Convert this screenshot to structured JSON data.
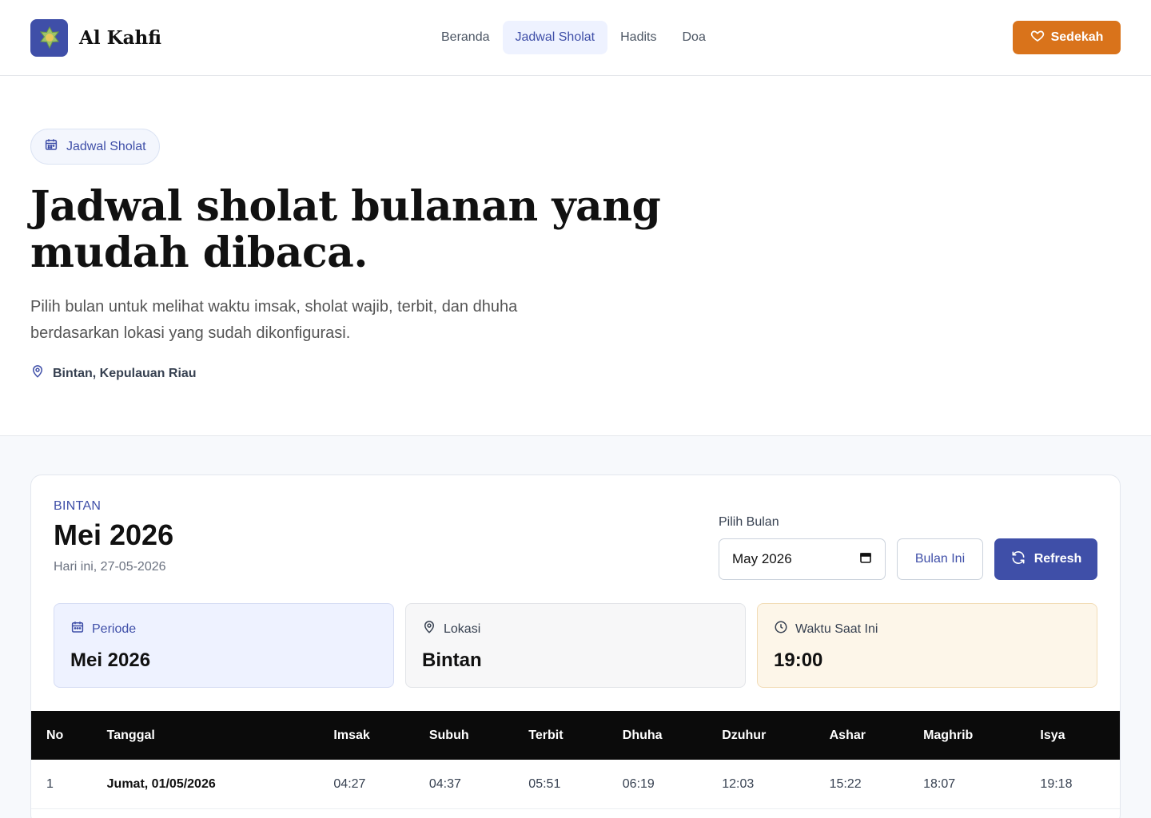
{
  "brand": {
    "name": "Al Kahfi",
    "logo_icon": "mosque-star-icon"
  },
  "nav": {
    "items": [
      {
        "label": "Beranda",
        "active": false
      },
      {
        "label": "Jadwal Sholat",
        "active": true
      },
      {
        "label": "Hadits",
        "active": false
      },
      {
        "label": "Doa",
        "active": false
      }
    ]
  },
  "donate": {
    "label": "Sedekah",
    "icon": "heart-icon"
  },
  "hero": {
    "badge": "Jadwal Sholat",
    "title": "Jadwal sholat bulanan yang mudah dibaca.",
    "description": "Pilih bulan untuk melihat waktu imsak, sholat wajib, terbit, dan dhuha berdasarkan lokasi yang sudah dikonfigurasi.",
    "location": "Bintan, Kepulauan Riau"
  },
  "schedule": {
    "city_kicker": "BINTAN",
    "title": "Mei 2026",
    "today": "Hari ini, 27-05-2026",
    "picker_label": "Pilih Bulan",
    "picker_value": "May 2026",
    "this_month_label": "Bulan Ini",
    "refresh_label": "Refresh"
  },
  "info": {
    "period": {
      "label": "Periode",
      "value": "Mei 2026"
    },
    "location": {
      "label": "Lokasi",
      "value": "Bintan"
    },
    "time": {
      "label": "Waktu Saat Ini",
      "value": "19:00"
    }
  },
  "table": {
    "headers": [
      "No",
      "Tanggal",
      "Imsak",
      "Subuh",
      "Terbit",
      "Dhuha",
      "Dzuhur",
      "Ashar",
      "Maghrib",
      "Isya"
    ],
    "rows": [
      [
        "1",
        "Jumat, 01/05/2026",
        "04:27",
        "04:37",
        "05:51",
        "06:19",
        "12:03",
        "15:22",
        "18:07",
        "19:18"
      ]
    ]
  },
  "colors": {
    "accent": "#3f4fa8",
    "donate": "#d9731b",
    "table_header": "#0b0b0b"
  }
}
